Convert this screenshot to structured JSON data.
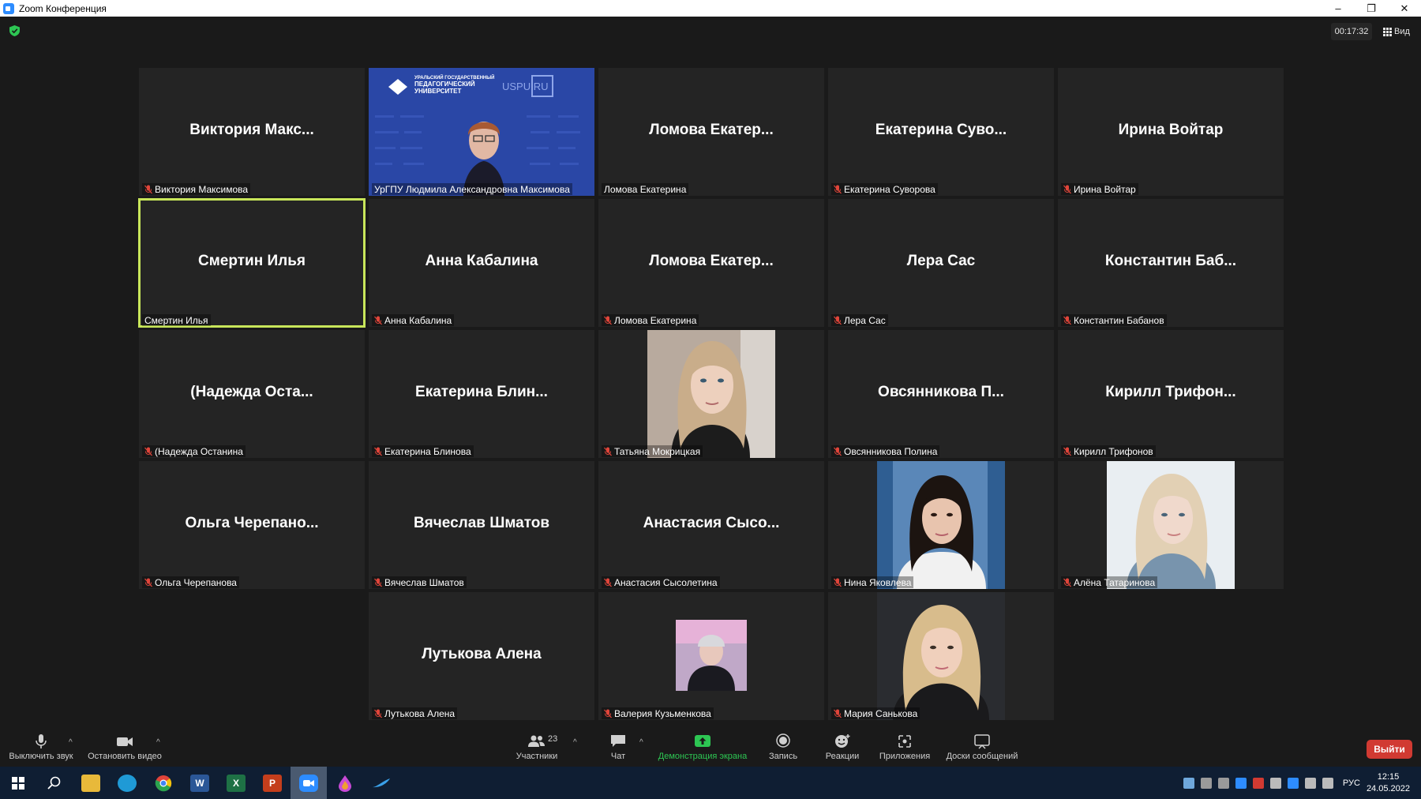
{
  "window": {
    "title": "Zoom Конференция",
    "minimize": "–",
    "restore": "❐",
    "close": "✕"
  },
  "meeting": {
    "timer": "00:17:32",
    "view_label": "Вид"
  },
  "tiles": [
    {
      "name": "Виктория Макс...",
      "label": "Виктория Максимова",
      "muted": true
    },
    {
      "name": "",
      "label": "УрГПУ Людмила Александровна Максимова",
      "muted": false,
      "banner_top": "УРАЛЬСКИЙ ГОСУДАРСТВЕННЫЙ",
      "banner_mid": "ПЕДАГОГИЧЕСКИЙ",
      "banner_bot": "УНИВЕРСИТЕТ",
      "site": "USPU.RU"
    },
    {
      "name": "Ломова Екатер...",
      "label": "Ломова Екатерина",
      "muted": false
    },
    {
      "name": "Екатерина Суво...",
      "label": "Екатерина Суворова",
      "muted": true
    },
    {
      "name": "Ирина Войтар",
      "label": "Ирина Войтар",
      "muted": true
    },
    {
      "name": "Смертин Илья",
      "label": "Смертин Илья",
      "muted": false
    },
    {
      "name": "Анна Кабалина",
      "label": "Анна Кабалина",
      "muted": true
    },
    {
      "name": "Ломова Екатер...",
      "label": "Ломова Екатерина",
      "muted": true
    },
    {
      "name": "Лера Сас",
      "label": "Лера Сас",
      "muted": true
    },
    {
      "name": "Константин Баб...",
      "label": "Константин Бабанов",
      "muted": true
    },
    {
      "name": "(Надежда Оста...",
      "label": "(Надежда Останина",
      "muted": true
    },
    {
      "name": "Екатерина Блин...",
      "label": "Екатерина Блинова",
      "muted": true
    },
    {
      "name": "",
      "label": "Татьяна Мокрицкая",
      "muted": true
    },
    {
      "name": "Овсянникова П...",
      "label": "Овсянникова Полина",
      "muted": true
    },
    {
      "name": "Кирилл Трифон...",
      "label": "Кирилл Трифонов",
      "muted": true
    },
    {
      "name": "Ольга Черепано...",
      "label": "Ольга Черепанова",
      "muted": true
    },
    {
      "name": "Вячеслав Шматов",
      "label": "Вячеслав Шматов",
      "muted": true
    },
    {
      "name": "Анастасия Сысо...",
      "label": "Анастасия Сысолетина",
      "muted": true
    },
    {
      "name": "",
      "label": "Нина Яковлева",
      "muted": true
    },
    {
      "name": "",
      "label": "Алёна Татаринова",
      "muted": true
    },
    {
      "name": "Лутькова Алена",
      "label": "Лутькова Алена",
      "muted": true
    },
    {
      "name": "",
      "label": "Валерия Кузьменкова",
      "muted": true
    },
    {
      "name": "",
      "label": "Мария Санькова",
      "muted": true
    }
  ],
  "toolbar": {
    "mute": "Выключить звук",
    "video": "Остановить видео",
    "participants": "Участники",
    "participants_count": "23",
    "chat": "Чат",
    "share": "Демонстрация экрана",
    "record": "Запись",
    "reactions": "Реакции",
    "apps": "Приложения",
    "whiteboards": "Доски сообщений",
    "leave": "Выйти",
    "caret": "^"
  },
  "taskbar": {
    "word": "W",
    "excel": "X",
    "ppt": "P",
    "lang": "РУС",
    "time": "12:15",
    "date": "24.05.2022"
  },
  "colors": {
    "accent_green": "#2dc653",
    "active_speaker": "#c8e65a",
    "leave_red": "#d13a32",
    "mute_red": "#e0453a"
  }
}
